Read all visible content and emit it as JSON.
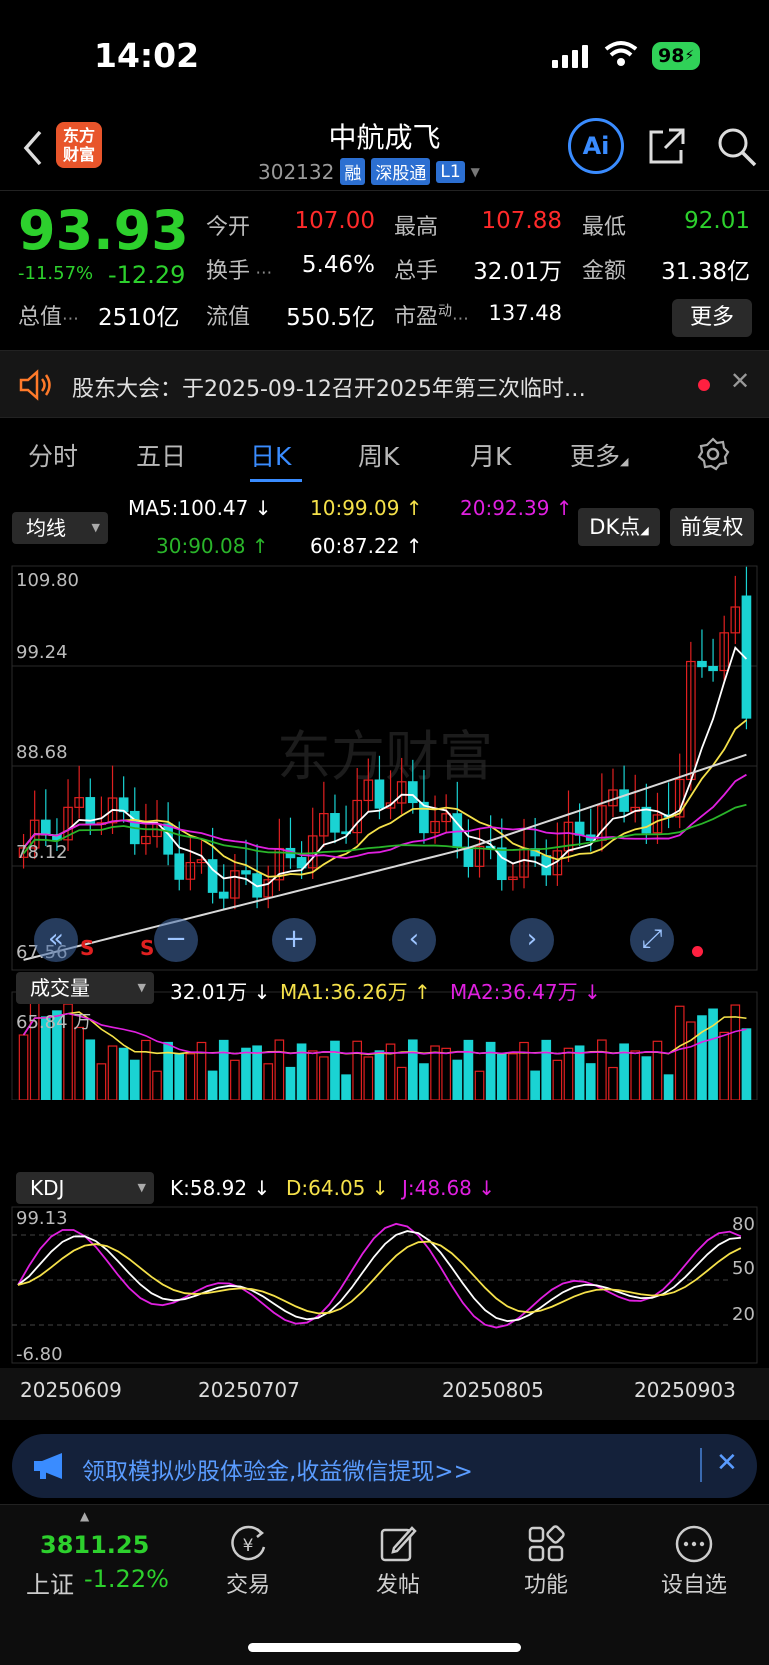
{
  "status": {
    "time": "14:02",
    "battery": "98"
  },
  "header": {
    "logo_line1": "东方",
    "logo_line2": "财富",
    "title": "中航成飞",
    "code": "302132",
    "tags": [
      "融",
      "深股通",
      "L1"
    ],
    "ai": "Ai"
  },
  "quote": {
    "price": "93.93",
    "pct": "-11.57%",
    "change": "-12.29",
    "open_label": "今开",
    "open": "107.00",
    "high_label": "最高",
    "high": "107.88",
    "low_label": "最低",
    "low": "92.01",
    "turnover_label": "换手",
    "turnover": "5.46%",
    "volume_label": "总手",
    "volume": "32.01万",
    "amount_label": "金额",
    "amount": "31.38亿",
    "mktcap_label": "总值",
    "mktcap": "2510亿",
    "float_label": "流值",
    "float": "550.5亿",
    "pe_label": "市盈",
    "pe_sup": "动",
    "pe": "137.48",
    "more": "更多"
  },
  "notice": {
    "text": "股东大会：于2025-09-12召开2025年第三次临时…"
  },
  "tabs": [
    "分时",
    "五日",
    "日K",
    "周K",
    "月K",
    "更多"
  ],
  "chart": {
    "ma_select": "均线",
    "ma5": "MA5:100.47 ↓",
    "ma10": "10:99.09 ↑",
    "ma20": "20:92.39 ↑",
    "ma30": "30:90.08 ↑",
    "ma60": "60:87.22 ↑",
    "dk": "DK点",
    "fq": "前复权",
    "ymax": "109.80",
    "y2": "99.24",
    "y3": "88.68",
    "y4": "78.12",
    "ymin": "67.56",
    "watermark": "东方财富",
    "s_marks": [
      "S",
      "S"
    ],
    "vol_select": "成交量",
    "vol_now": "32.01万 ↓",
    "vol_ma1": "MA1:36.26万 ↑",
    "vol_ma2": "MA2:36.47万 ↓",
    "vol_max": "65.84 万",
    "kdj_select": "KDJ",
    "k": "K:58.92 ↓",
    "d": "D:64.05 ↓",
    "j": "J:48.68 ↓",
    "kdj_max": "99.13",
    "kdj_min": "-6.80",
    "kdj_levels": [
      "80",
      "50",
      "20"
    ],
    "dates": [
      "20250609",
      "20250707",
      "20250805",
      "20250903"
    ],
    "colors": {
      "up": "#e02020",
      "down": "#1ad3d3",
      "ma5": "#ffffff",
      "ma10": "#f5e14a",
      "ma20": "#e020e0",
      "ma30": "#2ab52a",
      "ma60": "#d8d8d8"
    }
  },
  "ad": {
    "text": "领取模拟炒股体验金,收益微信提现>>"
  },
  "bottom": {
    "index_value": "3811.25",
    "index_name": "上证",
    "index_pct": "-1.22%",
    "nav": [
      "交易",
      "发帖",
      "功能",
      "设自选"
    ]
  },
  "chart_data": {
    "type": "candlestick",
    "x_range": [
      "20250609",
      "20250903"
    ],
    "ylim": [
      67.56,
      109.8
    ],
    "last": {
      "open": 107.0,
      "high": 107.88,
      "low": 92.01,
      "close": 93.93
    },
    "ma": {
      "MA5": 100.47,
      "MA10": 99.09,
      "MA20": 92.39,
      "MA30": 90.08,
      "MA60": 87.22
    },
    "volume": {
      "last": "32.01万",
      "MA1": "36.26万",
      "MA2": "36.47万",
      "max": "65.84万"
    },
    "kdj": {
      "K": 58.92,
      "D": 64.05,
      "J": 48.68,
      "ylim": [
        -6.8,
        99.13
      ]
    }
  }
}
